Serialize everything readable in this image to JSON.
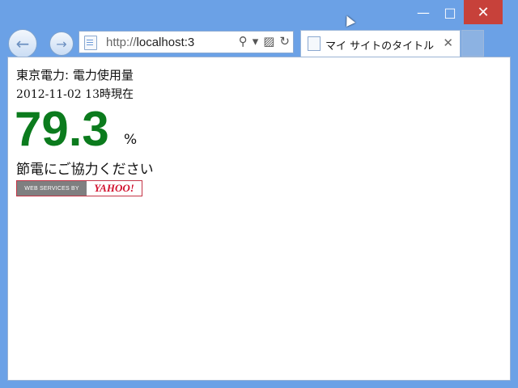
{
  "window": {
    "minimize_label": "—",
    "maximize_label": "□",
    "close_label": "✕"
  },
  "toolbar": {
    "back_label": "←",
    "forward_label": "→",
    "address": {
      "prefix": "http://",
      "host": "localhost:3",
      "search_label": "⚲",
      "dropdown_label": "▾",
      "compat_label": "▨",
      "refresh_label": "↻"
    }
  },
  "tab": {
    "title": "マイ サイトのタイトル",
    "close_label": "✕"
  },
  "page": {
    "title_line": "東京電力: 電力使用量",
    "timestamp_line": "2012-11-02 13時現在",
    "usage_value": "79.3",
    "usage_unit": "%",
    "message": "節電にご協力ください",
    "badge": {
      "left_text": "WEB SERVICES BY",
      "right_text": "YAHOO!"
    }
  },
  "colors": {
    "usage_value": "#0b7b1d",
    "window_frame": "#6ba1e6",
    "close_button": "#c7413a"
  }
}
